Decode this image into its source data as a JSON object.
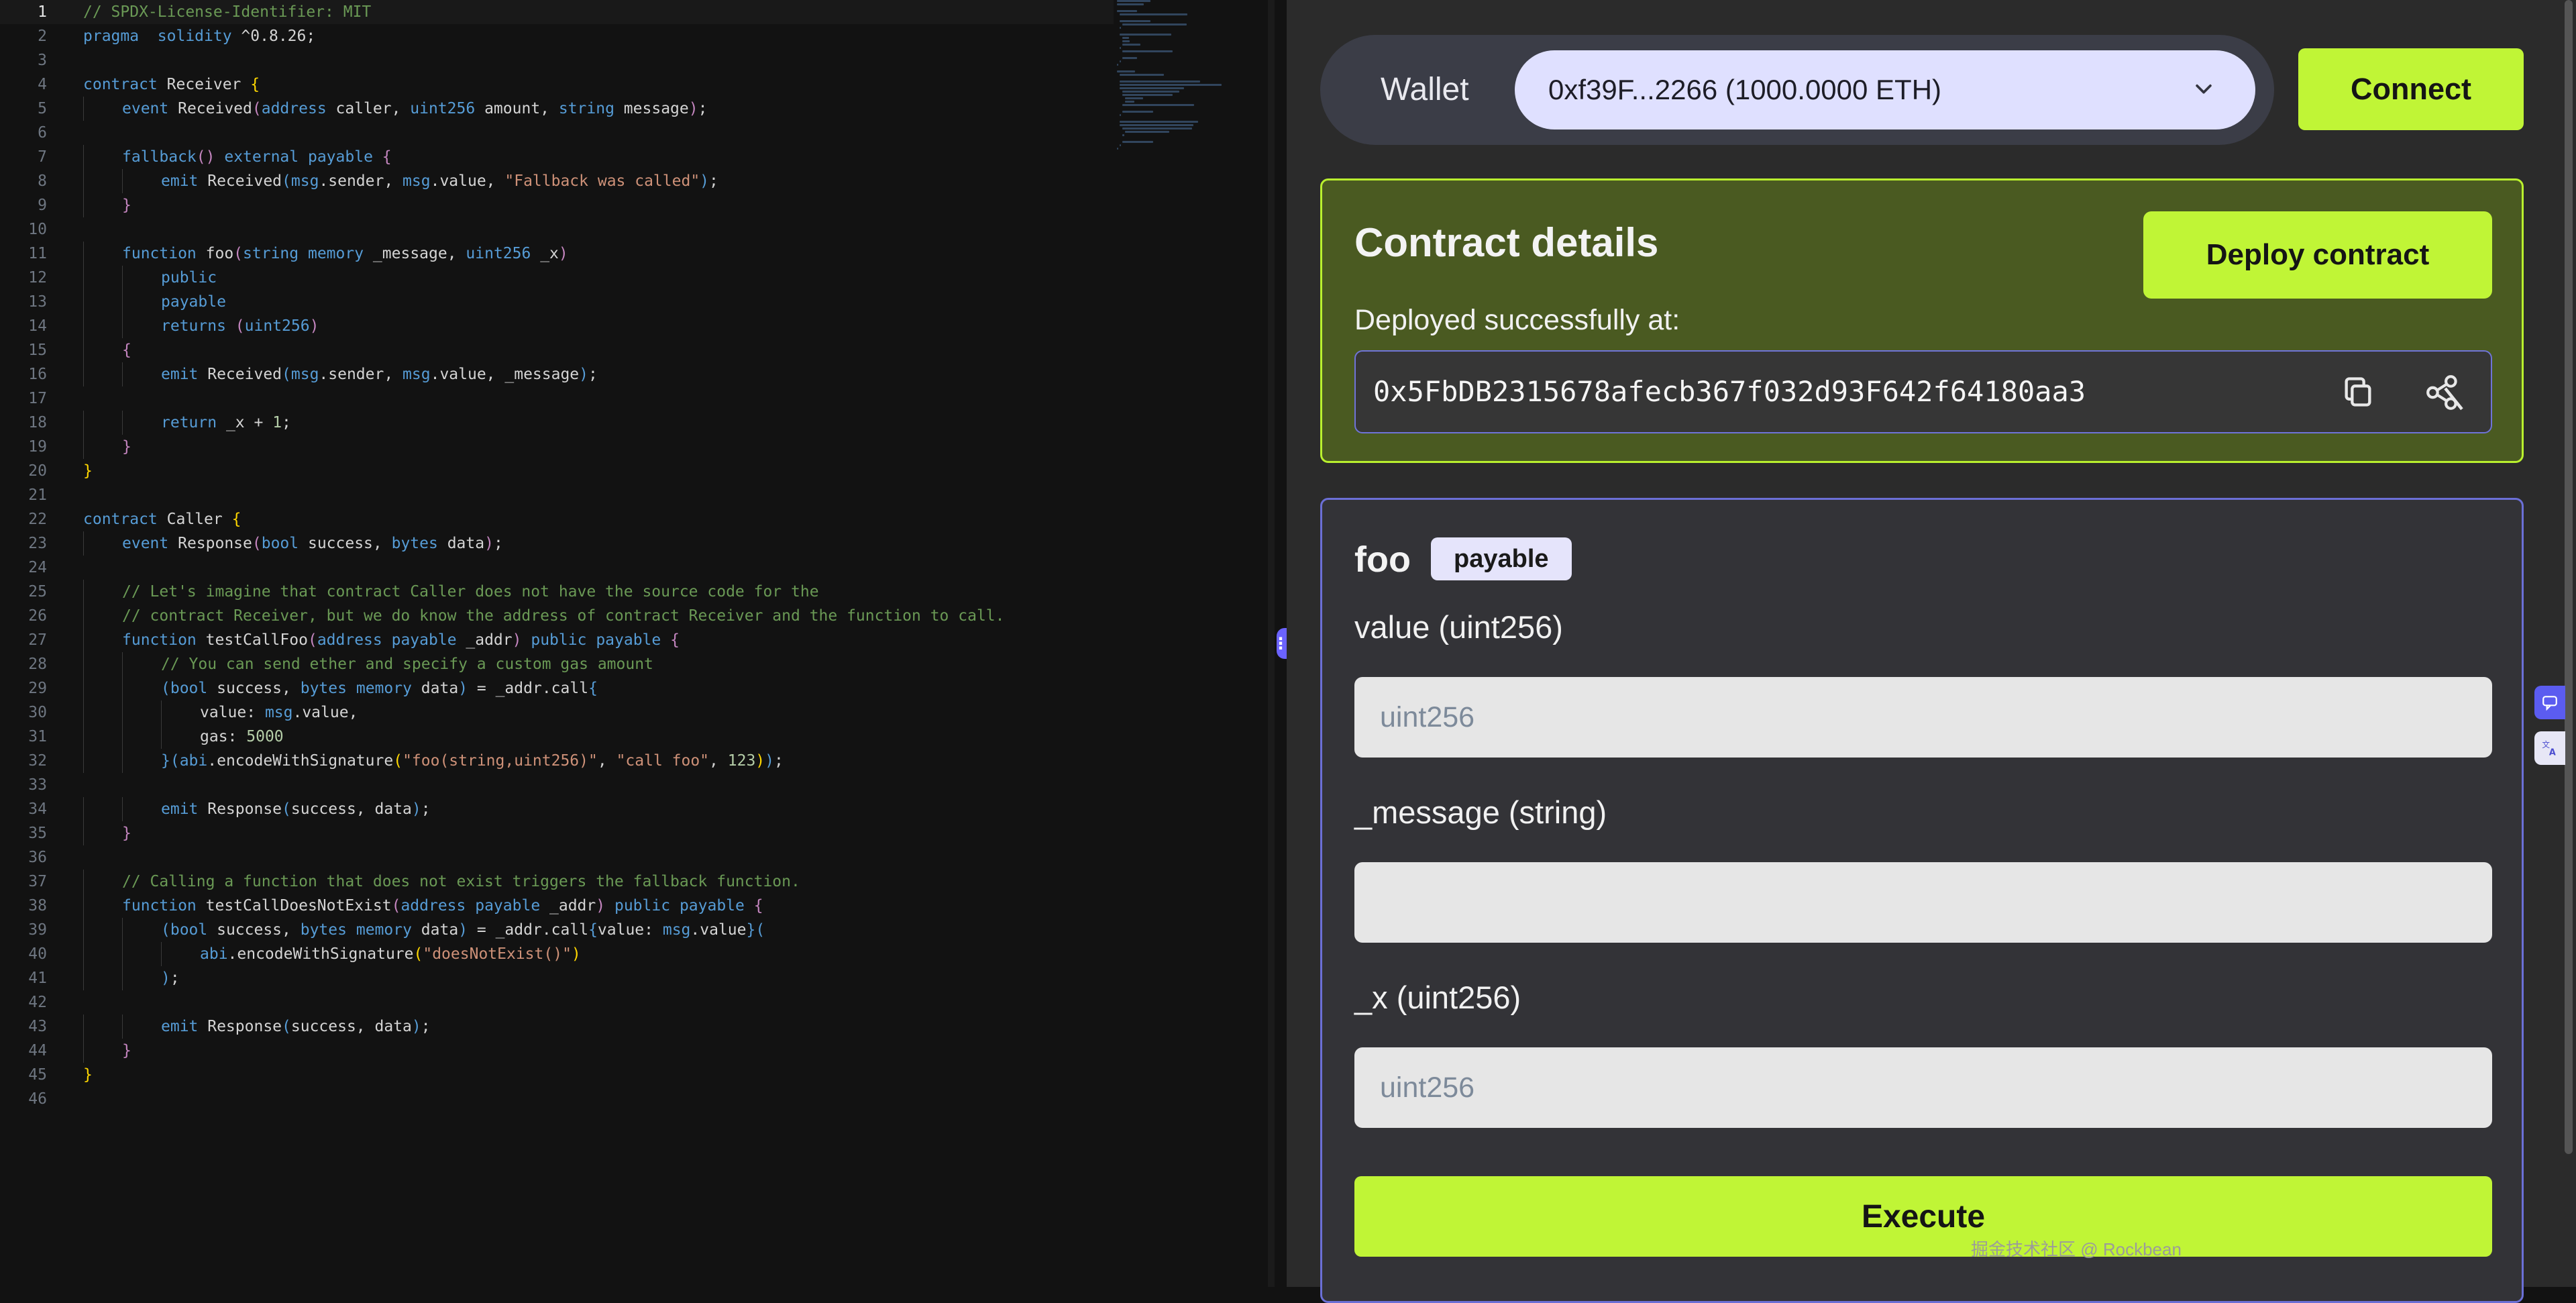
{
  "editor": {
    "lines": [
      {
        "n": "1",
        "current": true,
        "indent": 0,
        "tokens": [
          [
            "c",
            "// SPDX-License-Identifier: MIT"
          ]
        ]
      },
      {
        "n": "2",
        "indent": 0,
        "tokens": [
          [
            "k",
            "pragma"
          ],
          [
            "",
            "  "
          ],
          [
            "k",
            "solidity"
          ],
          [
            "",
            " ^0.8.26;"
          ]
        ]
      },
      {
        "n": "3",
        "indent": 0,
        "tokens": []
      },
      {
        "n": "4",
        "indent": 0,
        "tokens": [
          [
            "k",
            "contract"
          ],
          [
            "",
            " Receiver "
          ],
          [
            "y",
            "{"
          ]
        ]
      },
      {
        "n": "5",
        "indent": 1,
        "tokens": [
          [
            "k",
            "event"
          ],
          [
            "",
            " Received"
          ],
          [
            "p",
            "("
          ],
          [
            "k",
            "address"
          ],
          [
            "",
            " caller, "
          ],
          [
            "k",
            "uint256"
          ],
          [
            "",
            " amount, "
          ],
          [
            "k",
            "string"
          ],
          [
            "",
            " message"
          ],
          [
            "p",
            ")"
          ],
          [
            "",
            ";"
          ]
        ]
      },
      {
        "n": "6",
        "indent": 0,
        "tokens": []
      },
      {
        "n": "7",
        "indent": 1,
        "tokens": [
          [
            "k",
            "fallback"
          ],
          [
            "p",
            "()"
          ],
          [
            "",
            " "
          ],
          [
            "k",
            "external"
          ],
          [
            "",
            " "
          ],
          [
            "k",
            "payable"
          ],
          [
            "",
            " "
          ],
          [
            "p",
            "{"
          ]
        ]
      },
      {
        "n": "8",
        "indent": 2,
        "tokens": [
          [
            "k",
            "emit"
          ],
          [
            "",
            " Received"
          ],
          [
            "k",
            "("
          ],
          [
            "k",
            "msg"
          ],
          [
            "",
            ".sender, "
          ],
          [
            "k",
            "msg"
          ],
          [
            "",
            ".value, "
          ],
          [
            "s",
            "\"Fallback was called\""
          ],
          [
            "k",
            ")"
          ],
          [
            "",
            ";"
          ]
        ]
      },
      {
        "n": "9",
        "indent": 1,
        "tokens": [
          [
            "p",
            "}"
          ]
        ]
      },
      {
        "n": "10",
        "indent": 0,
        "tokens": []
      },
      {
        "n": "11",
        "indent": 1,
        "tokens": [
          [
            "k",
            "function"
          ],
          [
            "",
            " foo"
          ],
          [
            "p",
            "("
          ],
          [
            "k",
            "string"
          ],
          [
            "",
            " "
          ],
          [
            "k",
            "memory"
          ],
          [
            "",
            " _message, "
          ],
          [
            "k",
            "uint256"
          ],
          [
            "",
            " _x"
          ],
          [
            "p",
            ")"
          ]
        ]
      },
      {
        "n": "12",
        "indent": 2,
        "tokens": [
          [
            "k",
            "public"
          ]
        ]
      },
      {
        "n": "13",
        "indent": 2,
        "tokens": [
          [
            "k",
            "payable"
          ]
        ]
      },
      {
        "n": "14",
        "indent": 2,
        "tokens": [
          [
            "k",
            "returns"
          ],
          [
            "",
            " "
          ],
          [
            "p",
            "("
          ],
          [
            "k",
            "uint256"
          ],
          [
            "p",
            ")"
          ]
        ]
      },
      {
        "n": "15",
        "indent": 1,
        "tokens": [
          [
            "p",
            "{"
          ]
        ]
      },
      {
        "n": "16",
        "indent": 2,
        "tokens": [
          [
            "k",
            "emit"
          ],
          [
            "",
            " Received"
          ],
          [
            "k",
            "("
          ],
          [
            "k",
            "msg"
          ],
          [
            "",
            ".sender, "
          ],
          [
            "k",
            "msg"
          ],
          [
            "",
            ".value, _message"
          ],
          [
            "k",
            ")"
          ],
          [
            "",
            ";"
          ]
        ]
      },
      {
        "n": "17",
        "indent": 0,
        "tokens": []
      },
      {
        "n": "18",
        "indent": 2,
        "tokens": [
          [
            "k",
            "return"
          ],
          [
            "",
            " _x + "
          ],
          [
            "n",
            "1"
          ],
          [
            "",
            ";"
          ]
        ]
      },
      {
        "n": "19",
        "indent": 1,
        "tokens": [
          [
            "p",
            "}"
          ]
        ]
      },
      {
        "n": "20",
        "indent": 0,
        "tokens": [
          [
            "y",
            "}"
          ]
        ]
      },
      {
        "n": "21",
        "indent": 0,
        "tokens": []
      },
      {
        "n": "22",
        "indent": 0,
        "tokens": [
          [
            "k",
            "contract"
          ],
          [
            "",
            " Caller "
          ],
          [
            "y",
            "{"
          ]
        ]
      },
      {
        "n": "23",
        "indent": 1,
        "tokens": [
          [
            "k",
            "event"
          ],
          [
            "",
            " Response"
          ],
          [
            "p",
            "("
          ],
          [
            "k",
            "bool"
          ],
          [
            "",
            " success, "
          ],
          [
            "k",
            "bytes"
          ],
          [
            "",
            " data"
          ],
          [
            "p",
            ")"
          ],
          [
            "",
            ";"
          ]
        ]
      },
      {
        "n": "24",
        "indent": 0,
        "tokens": []
      },
      {
        "n": "25",
        "indent": 1,
        "tokens": [
          [
            "c",
            "// Let's imagine that contract Caller does not have the source code for the"
          ]
        ]
      },
      {
        "n": "26",
        "indent": 1,
        "tokens": [
          [
            "c",
            "// contract Receiver, but we do know the address of contract Receiver and the function to call."
          ]
        ]
      },
      {
        "n": "27",
        "indent": 1,
        "tokens": [
          [
            "k",
            "function"
          ],
          [
            "",
            " testCallFoo"
          ],
          [
            "p",
            "("
          ],
          [
            "k",
            "address"
          ],
          [
            "",
            " "
          ],
          [
            "k",
            "payable"
          ],
          [
            "",
            " _addr"
          ],
          [
            "p",
            ")"
          ],
          [
            "",
            " "
          ],
          [
            "k",
            "public"
          ],
          [
            "",
            " "
          ],
          [
            "k",
            "payable"
          ],
          [
            "",
            " "
          ],
          [
            "p",
            "{"
          ]
        ]
      },
      {
        "n": "28",
        "indent": 2,
        "tokens": [
          [
            "c",
            "// You can send ether and specify a custom gas amount"
          ]
        ]
      },
      {
        "n": "29",
        "indent": 2,
        "tokens": [
          [
            "k",
            "("
          ],
          [
            "k",
            "bool"
          ],
          [
            "",
            " success, "
          ],
          [
            "k",
            "bytes"
          ],
          [
            "",
            " "
          ],
          [
            "k",
            "memory"
          ],
          [
            "",
            " data"
          ],
          [
            "k",
            ")"
          ],
          [
            "",
            " = _addr.call"
          ],
          [
            "k",
            "{"
          ]
        ]
      },
      {
        "n": "30",
        "indent": 3,
        "tokens": [
          [
            "",
            "value: "
          ],
          [
            "k",
            "msg"
          ],
          [
            "",
            ".value,"
          ]
        ]
      },
      {
        "n": "31",
        "indent": 3,
        "tokens": [
          [
            "",
            "gas: "
          ],
          [
            "n",
            "5000"
          ]
        ]
      },
      {
        "n": "32",
        "indent": 2,
        "tokens": [
          [
            "k",
            "}("
          ],
          [
            "k",
            "abi"
          ],
          [
            "",
            ".encodeWithSignature"
          ],
          [
            "y",
            "("
          ],
          [
            "s",
            "\"foo(string,uint256)\""
          ],
          [
            "",
            ", "
          ],
          [
            "s",
            "\"call foo\""
          ],
          [
            "",
            ", "
          ],
          [
            "n",
            "123"
          ],
          [
            "y",
            ")"
          ],
          [
            "k",
            ")"
          ],
          [
            "",
            ";"
          ]
        ]
      },
      {
        "n": "33",
        "indent": 0,
        "tokens": []
      },
      {
        "n": "34",
        "indent": 2,
        "tokens": [
          [
            "k",
            "emit"
          ],
          [
            "",
            " Response"
          ],
          [
            "k",
            "("
          ],
          [
            "",
            "success, data"
          ],
          [
            "k",
            ")"
          ],
          [
            "",
            ";"
          ]
        ]
      },
      {
        "n": "35",
        "indent": 1,
        "tokens": [
          [
            "p",
            "}"
          ]
        ]
      },
      {
        "n": "36",
        "indent": 0,
        "tokens": []
      },
      {
        "n": "37",
        "indent": 1,
        "tokens": [
          [
            "c",
            "// Calling a function that does not exist triggers the fallback function."
          ]
        ]
      },
      {
        "n": "38",
        "indent": 1,
        "tokens": [
          [
            "k",
            "function"
          ],
          [
            "",
            " testCallDoesNotExist"
          ],
          [
            "p",
            "("
          ],
          [
            "k",
            "address"
          ],
          [
            "",
            " "
          ],
          [
            "k",
            "payable"
          ],
          [
            "",
            " _addr"
          ],
          [
            "p",
            ")"
          ],
          [
            "",
            " "
          ],
          [
            "k",
            "public"
          ],
          [
            "",
            " "
          ],
          [
            "k",
            "payable"
          ],
          [
            "",
            " "
          ],
          [
            "p",
            "{"
          ]
        ]
      },
      {
        "n": "39",
        "indent": 2,
        "tokens": [
          [
            "k",
            "("
          ],
          [
            "k",
            "bool"
          ],
          [
            "",
            " success, "
          ],
          [
            "k",
            "bytes"
          ],
          [
            "",
            " "
          ],
          [
            "k",
            "memory"
          ],
          [
            "",
            " data"
          ],
          [
            "k",
            ")"
          ],
          [
            "",
            " = _addr.call"
          ],
          [
            "k",
            "{"
          ],
          [
            "",
            "value: "
          ],
          [
            "k",
            "msg"
          ],
          [
            "",
            ".value"
          ],
          [
            "k",
            "}("
          ]
        ]
      },
      {
        "n": "40",
        "indent": 3,
        "tokens": [
          [
            "k",
            "abi"
          ],
          [
            "",
            ".encodeWithSignature"
          ],
          [
            "y",
            "("
          ],
          [
            "s",
            "\"doesNotExist()\""
          ],
          [
            "y",
            ")"
          ]
        ]
      },
      {
        "n": "41",
        "indent": 2,
        "tokens": [
          [
            "k",
            ")"
          ],
          [
            "",
            ";"
          ]
        ]
      },
      {
        "n": "42",
        "indent": 0,
        "tokens": []
      },
      {
        "n": "43",
        "indent": 2,
        "tokens": [
          [
            "k",
            "emit"
          ],
          [
            "",
            " Response"
          ],
          [
            "k",
            "("
          ],
          [
            "",
            "success, data"
          ],
          [
            "k",
            ")"
          ],
          [
            "",
            ";"
          ]
        ]
      },
      {
        "n": "44",
        "indent": 1,
        "tokens": [
          [
            "p",
            "}"
          ]
        ]
      },
      {
        "n": "45",
        "indent": 0,
        "tokens": [
          [
            "y",
            "}"
          ]
        ]
      },
      {
        "n": "46",
        "indent": 0,
        "tokens": []
      }
    ]
  },
  "wallet": {
    "label": "Wallet",
    "selected": "0xf39F...2266 (1000.0000 ETH)",
    "connect_label": "Connect"
  },
  "contract_details": {
    "title": "Contract details",
    "deploy_label": "Deploy contract",
    "deployed_label": "Deployed successfully at:",
    "address": "0x5FbDB2315678afecb367f032d93F642f64180aa3"
  },
  "function": {
    "name": "foo",
    "badge": "payable",
    "params": [
      {
        "label": "value (uint256)",
        "placeholder": "uint256",
        "value": ""
      },
      {
        "label": "_message (string)",
        "placeholder": "",
        "value": ""
      },
      {
        "label": "_x (uint256)",
        "placeholder": "uint256",
        "value": ""
      }
    ],
    "execute_label": "Execute"
  },
  "watermark": "掘金技术社区 @ Rockbean",
  "colors": {
    "accent": "#c0f536",
    "panel_bg": "#2b2b2b",
    "details_bg": "#4a5a21",
    "function_border": "#6b6fd6"
  }
}
